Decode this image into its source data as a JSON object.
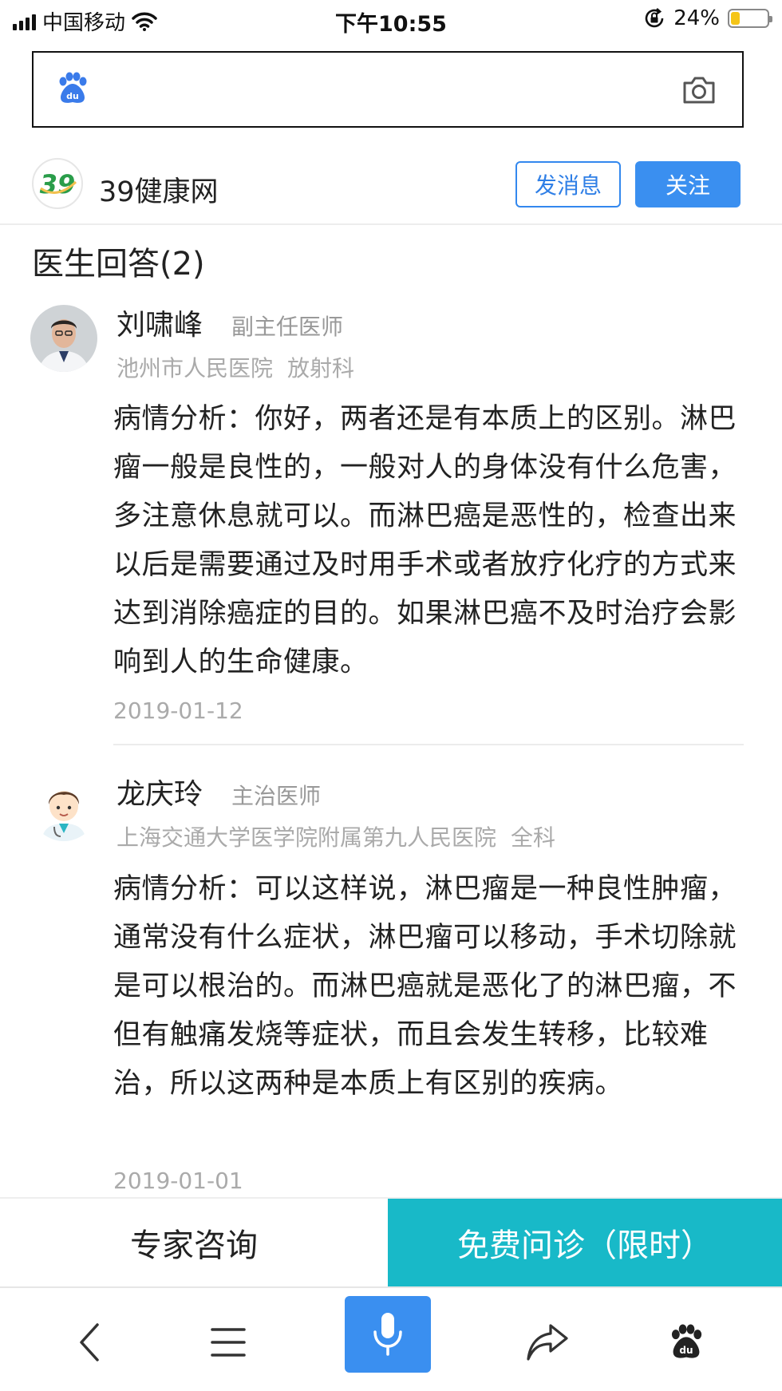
{
  "status_bar": {
    "carrier": "中国移动",
    "time": "下午10:55",
    "battery_percent": "24%",
    "battery_level": 0.24
  },
  "search": {
    "placeholder": ""
  },
  "site": {
    "logo_text": "39",
    "name": "39健康网",
    "message_button": "发消息",
    "follow_button": "关注"
  },
  "section": {
    "title": "医生回答(2)"
  },
  "answers": [
    {
      "doctor_name": "刘啸峰",
      "doctor_title": "副主任医师",
      "hospital": "池州市人民医院",
      "department": "放射科",
      "text": "病情分析：你好，两者还是有本质上的区别。淋巴瘤一般是良性的，一般对人的身体没有什么危害，多注意休息就可以。而淋巴癌是恶性的，检查出来以后是需要通过及时用手术或者放疗化疗的方式来达到消除癌症的目的。如果淋巴癌不及时治疗会影响到人的生命健康。",
      "date": "2019-01-12"
    },
    {
      "doctor_name": "龙庆玲",
      "doctor_title": "主治医师",
      "hospital": "上海交通大学医学院附属第九人民医院",
      "department": "全科",
      "text": "病情分析：可以这样说，淋巴瘤是一种良性肿瘤，通常没有什么症状，淋巴瘤可以移动，手术切除就是可以根治的。而淋巴癌就是恶化了的淋巴瘤，不但有触痛发烧等症状，而且会发生转移，比较难治，所以这两种是本质上有区别的疾病。",
      "date": "2019-01-01"
    }
  ],
  "cta": {
    "consult_label": "专家咨询",
    "free_label": "免费问诊（限时）"
  },
  "nav": {
    "items": [
      "back-icon",
      "menu-icon",
      "microphone-icon",
      "share-icon",
      "baidu-paw-icon"
    ]
  },
  "colors": {
    "brand_blue": "#3a8ff0",
    "cta_teal": "#18b9c8",
    "muted_text": "#aaaaaa"
  }
}
